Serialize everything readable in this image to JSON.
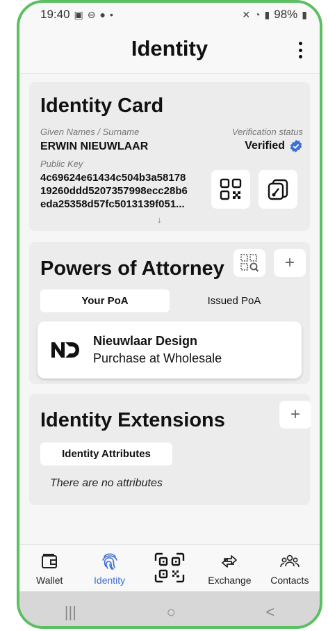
{
  "status_bar": {
    "time": "19:40",
    "battery": "98%"
  },
  "header": {
    "title": "Identity"
  },
  "identity_card": {
    "title": "Identity Card",
    "name_label": "Given Names / Surname",
    "name_value": "ERWIN NIEUWLAAR",
    "verification_label": "Verification status",
    "verification_value": "Verified",
    "public_key_label": "Public Key",
    "public_key_lines": [
      "4c69624e61434c504b3a58178",
      "19260ddd5207357998ecc28b6",
      "eda25358d57fc5013139f051..."
    ],
    "expand_glyph": "↓"
  },
  "poa": {
    "title": "Powers of Attorney",
    "add_glyph": "+",
    "tabs": [
      {
        "label": "Your PoA",
        "active": true
      },
      {
        "label": "Issued PoA",
        "active": false
      }
    ],
    "items": [
      {
        "logo": "ND",
        "name": "Nieuwlaar Design",
        "description": "Purchase at Wholesale"
      }
    ]
  },
  "extensions": {
    "title": "Identity Extensions",
    "add_glyph": "+",
    "tab_label": "Identity Attributes",
    "empty_text": "There are no attributes"
  },
  "nav": [
    {
      "label": "Wallet",
      "icon": "wallet-icon",
      "active": false
    },
    {
      "label": "Identity",
      "icon": "fingerprint-icon",
      "active": true
    },
    {
      "label": "",
      "icon": "qr-scan-icon",
      "active": false
    },
    {
      "label": "Exchange",
      "icon": "exchange-icon",
      "active": false
    },
    {
      "label": "Contacts",
      "icon": "contacts-icon",
      "active": false
    }
  ],
  "system_nav": {
    "recents": "|||",
    "home": "○",
    "back": "<"
  },
  "colors": {
    "accent": "#3d6fd6",
    "frame": "#5cbf62",
    "card": "#ececec"
  }
}
